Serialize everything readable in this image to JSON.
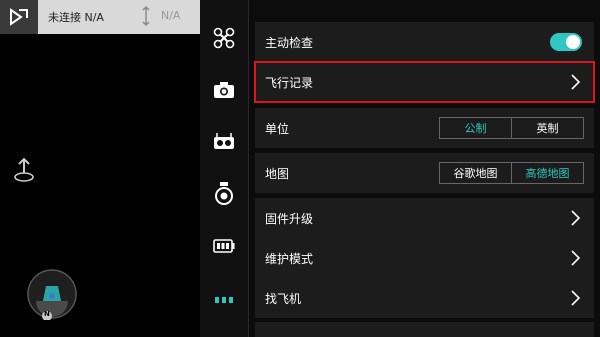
{
  "status": {
    "connection": "未连接 N/A",
    "altitude": "N/A"
  },
  "settings": {
    "auto_check": {
      "label": "主动检查",
      "enabled": true
    },
    "flight_record": {
      "label": "飞行记录"
    },
    "unit": {
      "label": "单位",
      "options": [
        "公制",
        "英制"
      ],
      "selected": "公制"
    },
    "map": {
      "label": "地图",
      "options": [
        "谷歌地图",
        "高德地图"
      ],
      "selected": "高德地图"
    },
    "firmware": {
      "label": "固件升级"
    },
    "maintenance": {
      "label": "维护模式"
    },
    "find_drone": {
      "label": "找飞机"
    }
  },
  "compass": {
    "heading": "N"
  },
  "colors": {
    "accent": "#2ec7c2",
    "highlight": "#d9161c"
  },
  "toolbar_icons": [
    "drone-icon",
    "camera-icon",
    "remote-controller-icon",
    "gimbal-icon",
    "battery-icon",
    "more-icon"
  ]
}
